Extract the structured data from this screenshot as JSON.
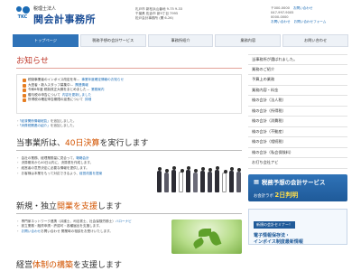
{
  "header": {
    "logo_sub": "税理士法人",
    "logo_name": "関会計事務所",
    "logo_tkc": "TKC",
    "address_lines": [
      "札戸市 新松浜山番地 9-75 9-33",
      "千葉県 佐倉市 新9丁目 7995",
      "松戸会計事務所 (関 6-26)"
    ],
    "contact_lines": [
      "〒000-0000",
      "047-997-9005",
      "0000-0000"
    ],
    "contact_links": [
      "お問い合わせ",
      "お問い合わせフォーム"
    ],
    "contact_right": "お問い合わせ"
  },
  "nav": {
    "items": [
      "トップページ",
      "税務予想の会計サービス",
      "事務所紹介",
      "業務内容",
      "お問い合わせ"
    ],
    "active_index": 0
  },
  "news": {
    "title": "お知らせ",
    "items": [
      {
        "text": "税制事業者のインボイス改定を年…",
        "link": "事業年度確定情報のお知らせ"
      },
      {
        "text": "大担者・新人スタッフ募集中…",
        "link": "関連情報"
      },
      {
        "text": "令和6年度 税制改正大綱をまとめました…",
        "link": "業務案内"
      },
      {
        "text": "贈与税の申告について",
        "link": "内容を更新しました"
      },
      {
        "text": "所得税の確定申告期限の延長について",
        "link": "詳細"
      }
    ]
  },
  "notes": [
    {
      "prefix": "・",
      "link": "「経済関係情報総覧」",
      "text": "を追加しました。"
    },
    {
      "prefix": "・",
      "link": "「消費税関連の紹介」",
      "text": "を追加しました。"
    }
  ],
  "section2": {
    "title_pre": "当事業所は、",
    "title_hl": "40日決算",
    "title_post": "を実行します",
    "bullets": [
      {
        "text": "会社の業務、経理業務量に見合って、",
        "link": "戦略会計"
      },
      {
        "text": "決算期末から40日以内に、決算書を作成します。",
        "link": ""
      },
      {
        "text": "経営者の意思決定に必要な情報を提供します。",
        "link": ""
      },
      {
        "text": "お客様は本業をもって対応できるよう、",
        "link": "経営改善を提案"
      }
    ]
  },
  "section3": {
    "title_pre": "新規・独立",
    "title_hl": "開業を支援",
    "title_post": "します",
    "bullets": [
      {
        "text": "専門家ネットワーク連携（弁護士、司法書士、社会保険労務士）",
        "link": "ハローナビ"
      },
      {
        "text": "設立業務・融資申請・許認可・各種届出を支援します。",
        "link": ""
      },
      {
        "text": "お問い合わせ 開業時の相談をお受けいたします。",
        "link": "お問い合わせ"
      }
    ]
  },
  "section4": {
    "title_pre": "経営",
    "title_hl": "体制の構築",
    "title_post": "を支援します"
  },
  "sidebar": {
    "items": [
      "当事務所が選ばれました。",
      "業務のご紹介",
      "予算上の業務",
      "業務内容・料金",
      "検の会計（法人税）",
      "検の会計（所得税）",
      "検の会計（消費税）",
      "検の会計（不動産）",
      "検の会計（相続税）",
      "検の会計（私会保険料）",
      "お打ち会社ナビ"
    ],
    "banner1_title": "税務予想の会計サービス",
    "banner1_line_pre": "お会計ラボ",
    "banner1_line_big": "2日判明",
    "banner2_tag": "新規の会計セミナー！",
    "banner2_l1": "電子情報保存法・",
    "banner2_l2": "インボイス制度最新情報"
  }
}
